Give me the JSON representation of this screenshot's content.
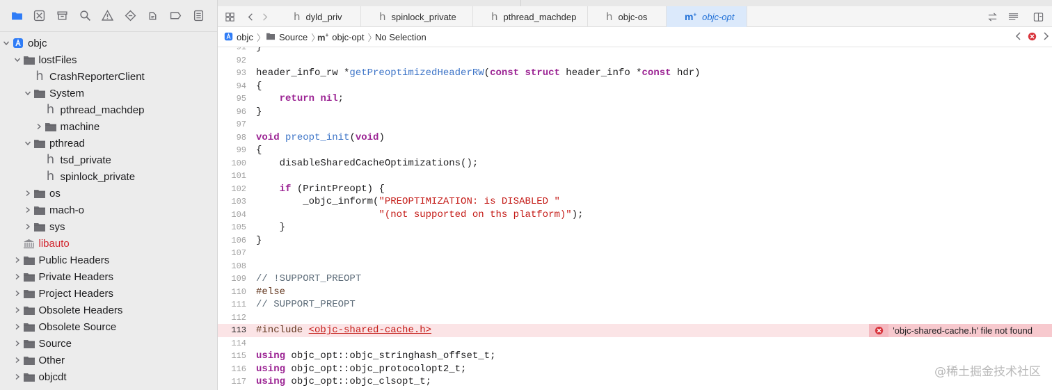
{
  "navigator": {
    "toolbar_icons": [
      "folder-icon",
      "source-control-icon",
      "symbol-icon",
      "find-icon",
      "issue-icon",
      "test-icon",
      "debug-icon",
      "breakpoint-icon",
      "report-icon"
    ],
    "tree": [
      {
        "label": "objc",
        "kind": "project",
        "indent": 0,
        "chevron": "open"
      },
      {
        "label": "lostFiles",
        "kind": "folder",
        "indent": 1,
        "chevron": "open"
      },
      {
        "label": "CrashReporterClient",
        "kind": "header",
        "indent": 2,
        "chevron": "none"
      },
      {
        "label": "System",
        "kind": "folder",
        "indent": 2,
        "chevron": "open"
      },
      {
        "label": "pthread_machdep",
        "kind": "header",
        "indent": 3,
        "chevron": "none"
      },
      {
        "label": "machine",
        "kind": "folder",
        "indent": 3,
        "chevron": "closed"
      },
      {
        "label": "pthread",
        "kind": "folder",
        "indent": 2,
        "chevron": "open"
      },
      {
        "label": "tsd_private",
        "kind": "header",
        "indent": 3,
        "chevron": "none"
      },
      {
        "label": "spinlock_private",
        "kind": "header",
        "indent": 3,
        "chevron": "none"
      },
      {
        "label": "os",
        "kind": "folder",
        "indent": 2,
        "chevron": "closed"
      },
      {
        "label": "mach-o",
        "kind": "folder",
        "indent": 2,
        "chevron": "closed"
      },
      {
        "label": "sys",
        "kind": "folder",
        "indent": 2,
        "chevron": "closed"
      },
      {
        "label": "libauto",
        "kind": "library",
        "indent": 1,
        "chevron": "none",
        "red": true
      },
      {
        "label": "Public Headers",
        "kind": "folder",
        "indent": 1,
        "chevron": "closed"
      },
      {
        "label": "Private Headers",
        "kind": "folder",
        "indent": 1,
        "chevron": "closed"
      },
      {
        "label": "Project Headers",
        "kind": "folder",
        "indent": 1,
        "chevron": "closed"
      },
      {
        "label": "Obsolete Headers",
        "kind": "folder",
        "indent": 1,
        "chevron": "closed"
      },
      {
        "label": "Obsolete Source",
        "kind": "folder",
        "indent": 1,
        "chevron": "closed"
      },
      {
        "label": "Source",
        "kind": "folder",
        "indent": 1,
        "chevron": "closed"
      },
      {
        "label": "Other",
        "kind": "folder",
        "indent": 1,
        "chevron": "closed"
      },
      {
        "label": "objcdt",
        "kind": "folder",
        "indent": 1,
        "chevron": "closed"
      }
    ]
  },
  "tabs": [
    {
      "label": "dyld_priv",
      "kind": "h",
      "active": false
    },
    {
      "label": "spinlock_private",
      "kind": "h",
      "active": false
    },
    {
      "label": "pthread_machdep",
      "kind": "h",
      "active": false
    },
    {
      "label": "objc-os",
      "kind": "h",
      "active": false
    },
    {
      "label": "objc-opt",
      "kind": "m",
      "active": true
    }
  ],
  "jumpbar": {
    "project": "objc",
    "folder": "Source",
    "file": "objc-opt",
    "selection": "No Selection"
  },
  "code": [
    {
      "n": "91",
      "segs": [
        [
          "",
          "}"
        ]
      ]
    },
    {
      "n": "92",
      "segs": []
    },
    {
      "n": "93",
      "segs": [
        [
          "",
          "header_info_rw *"
        ],
        [
          "fn",
          "getPreoptimizedHeaderRW"
        ],
        [
          "",
          "("
        ],
        [
          "kw",
          "const"
        ],
        [
          "",
          " "
        ],
        [
          "kw",
          "struct"
        ],
        [
          "",
          " header_info *"
        ],
        [
          "kw",
          "const"
        ],
        [
          "",
          " hdr)"
        ]
      ]
    },
    {
      "n": "94",
      "segs": [
        [
          "",
          "{"
        ]
      ]
    },
    {
      "n": "95",
      "segs": [
        [
          "",
          "    "
        ],
        [
          "kw",
          "return"
        ],
        [
          "",
          " "
        ],
        [
          "kw",
          "nil"
        ],
        [
          "",
          ";"
        ]
      ]
    },
    {
      "n": "96",
      "segs": [
        [
          "",
          "}"
        ]
      ]
    },
    {
      "n": "97",
      "segs": []
    },
    {
      "n": "98",
      "segs": [
        [
          "kw",
          "void"
        ],
        [
          "",
          " "
        ],
        [
          "fn",
          "preopt_init"
        ],
        [
          "",
          "("
        ],
        [
          "kw",
          "void"
        ],
        [
          "",
          ")"
        ]
      ]
    },
    {
      "n": "99",
      "segs": [
        [
          "",
          "{"
        ]
      ]
    },
    {
      "n": "100",
      "segs": [
        [
          "",
          "    disableSharedCacheOptimizations();"
        ]
      ]
    },
    {
      "n": "101",
      "segs": []
    },
    {
      "n": "102",
      "segs": [
        [
          "",
          "    "
        ],
        [
          "kw",
          "if"
        ],
        [
          "",
          " (PrintPreopt) {"
        ]
      ]
    },
    {
      "n": "103",
      "segs": [
        [
          "",
          "        _objc_inform("
        ],
        [
          "str",
          "\"PREOPTIMIZATION: is DISABLED \""
        ]
      ]
    },
    {
      "n": "104",
      "segs": [
        [
          "",
          "                     "
        ],
        [
          "str",
          "\"(not supported on ths platform)\""
        ],
        [
          "",
          ");"
        ]
      ]
    },
    {
      "n": "105",
      "segs": [
        [
          "",
          "    }"
        ]
      ]
    },
    {
      "n": "106",
      "segs": [
        [
          "",
          "}"
        ]
      ]
    },
    {
      "n": "107",
      "segs": []
    },
    {
      "n": "108",
      "segs": []
    },
    {
      "n": "109",
      "segs": [
        [
          "cm",
          "// !SUPPORT_PREOPT"
        ]
      ]
    },
    {
      "n": "110",
      "segs": [
        [
          "pp",
          "#else"
        ]
      ]
    },
    {
      "n": "111",
      "segs": [
        [
          "cm",
          "// SUPPORT_PREOPT"
        ]
      ]
    },
    {
      "n": "112",
      "segs": []
    },
    {
      "n": "113",
      "segs": [
        [
          "pp",
          "#include "
        ],
        [
          "inc",
          "<objc-shared-cache.h>"
        ]
      ],
      "error": true
    },
    {
      "n": "114",
      "segs": []
    },
    {
      "n": "115",
      "segs": [
        [
          "kw",
          "using"
        ],
        [
          "",
          " objc_opt::objc_stringhash_offset_t;"
        ]
      ]
    },
    {
      "n": "116",
      "segs": [
        [
          "kw",
          "using"
        ],
        [
          "",
          " objc_opt::objc_protocolopt2_t;"
        ]
      ]
    },
    {
      "n": "117",
      "segs": [
        [
          "kw",
          "using"
        ],
        [
          "",
          " objc_opt::objc_clsopt_t;"
        ]
      ]
    }
  ],
  "error_message": "'objc-shared-cache.h' file not found",
  "watermark": "@稀土掘金技术社区"
}
